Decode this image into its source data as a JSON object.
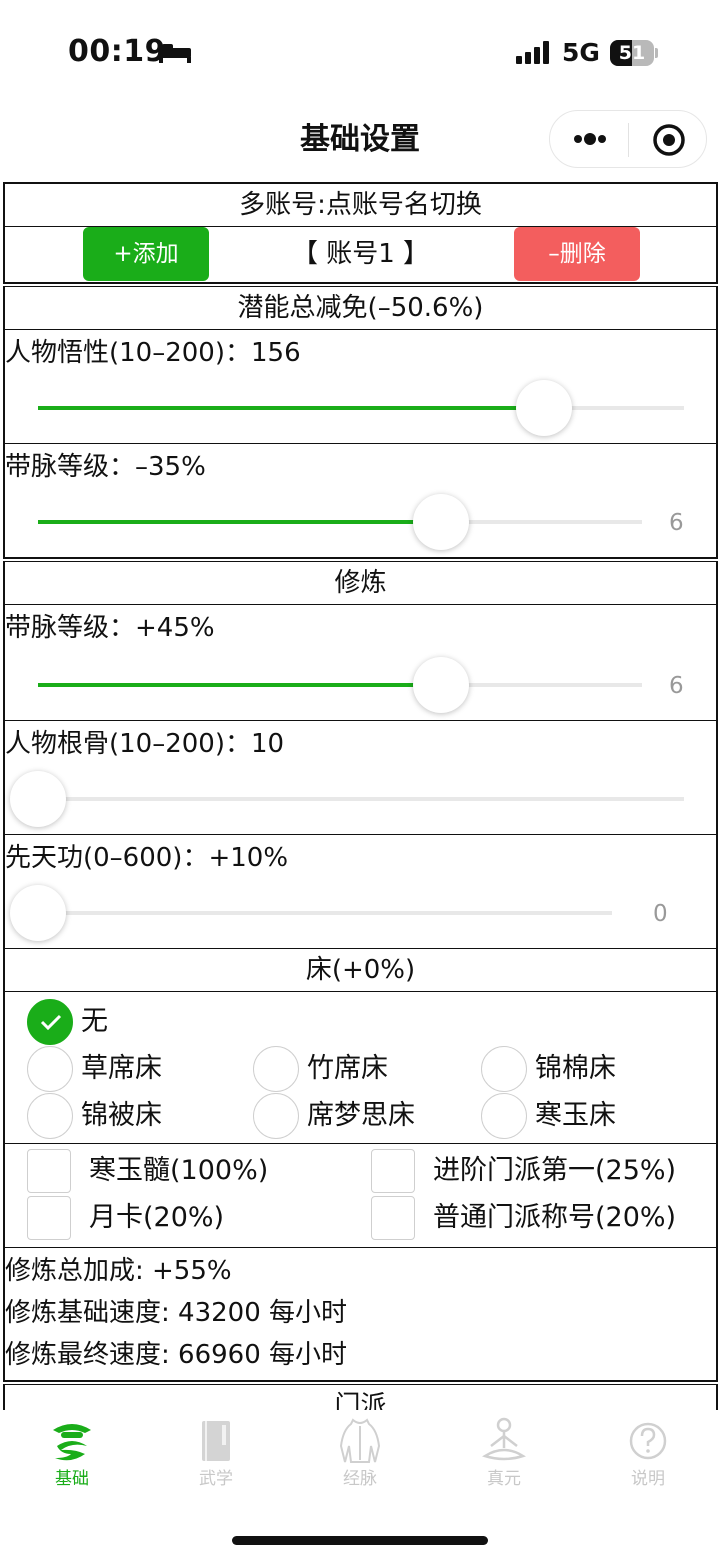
{
  "status_bar": {
    "time": "00:19",
    "network": "5G",
    "battery_level": "51",
    "battery_fraction": 0.51
  },
  "nav": {
    "title": "基础设置",
    "more_icon": "more-dots-icon",
    "close_icon": "target-close-icon"
  },
  "accounts": {
    "title": "多账号:点账号名切换",
    "add_label": "+添加",
    "current": "【 账号1 】",
    "delete_label": "–删除",
    "colors": {
      "add": "#1aad19",
      "delete": "#f35e5e"
    }
  },
  "potential": {
    "title": "潜能总减免(–50.6%)",
    "sliders": [
      {
        "label": "人物悟性(10–200)：156",
        "fraction": 0.783,
        "value": ""
      },
      {
        "label": "带脉等级：–35%",
        "fraction": 0.668,
        "value": "6"
      }
    ]
  },
  "cultivation": {
    "title": "修炼",
    "sliders": [
      {
        "label": "带脉等级：+45%",
        "fraction": 0.668,
        "value": "6"
      },
      {
        "label": "人物根骨(10–200)：10",
        "fraction": 0.0,
        "value": ""
      },
      {
        "label": "先天功(0–600)：+10%",
        "fraction": 0.0,
        "value": "0"
      }
    ]
  },
  "bed": {
    "title": "床(+0%)",
    "options": [
      "无",
      "草席床",
      "竹席床",
      "锦棉床",
      "锦被床",
      "席梦思床",
      "寒玉床"
    ],
    "selected": "无"
  },
  "bonuses": {
    "items": [
      "寒玉髓(100%)",
      "进阶门派第一(25%)",
      "月卡(20%)",
      "普通门派称号(20%)"
    ]
  },
  "summary": {
    "total": "修炼总加成: +55%",
    "base_speed": "修炼基础速度: 43200 每小时",
    "final_speed": "修炼最终速度: 66960 每小时"
  },
  "sect": {
    "title": "门派"
  },
  "tabbar": {
    "active_color": "#1aad19",
    "inactive_color": "#c8c8c8",
    "tabs": [
      {
        "label": "基础",
        "icon": "basics-icon",
        "active": true
      },
      {
        "label": "武学",
        "icon": "martial-book-icon",
        "active": false
      },
      {
        "label": "经脉",
        "icon": "meridian-icon",
        "active": false
      },
      {
        "label": "真元",
        "icon": "meditation-icon",
        "active": false
      },
      {
        "label": "说明",
        "icon": "help-icon",
        "active": false
      }
    ]
  },
  "accent_color": "#1aad19"
}
